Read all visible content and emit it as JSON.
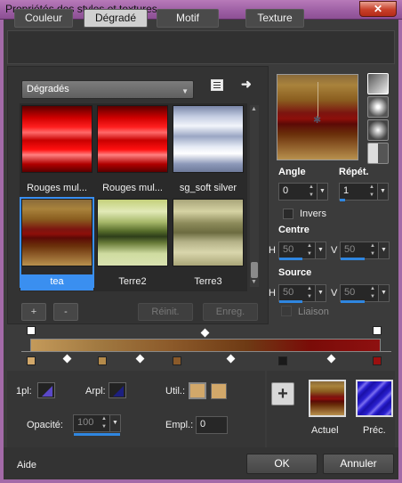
{
  "window": {
    "title": "Propriétés des styles et textures",
    "close": "✕"
  },
  "tabs": [
    "Couleur",
    "Dégradé",
    "Motif",
    "Texture"
  ],
  "category": {
    "value": "Dégradés"
  },
  "gradients": [
    {
      "name": "Rouges mul..."
    },
    {
      "name": "Rouges mul..."
    },
    {
      "name": "sg_soft silver"
    },
    {
      "name": "tea",
      "selected": true
    },
    {
      "name": "Terre2"
    },
    {
      "name": "Terre3"
    }
  ],
  "list_buttons": {
    "add": "+",
    "remove": "-",
    "reset": "Réinit.",
    "save": "Enreg."
  },
  "angle": {
    "label": "Angle",
    "value": "0"
  },
  "repeat": {
    "label": "Répét.",
    "value": "1"
  },
  "invert": {
    "label": "Invers"
  },
  "center": {
    "label": "Centre",
    "h_label": "H",
    "h_value": "50",
    "v_label": "V",
    "v_value": "50"
  },
  "source": {
    "label": "Source",
    "h_label": "H",
    "h_value": "50",
    "v_label": "V",
    "v_value": "50"
  },
  "link": {
    "label": "Liaison"
  },
  "stops": {
    "first_label": "1pl:",
    "arpl_label": "Arpl:",
    "util_label": "Util.:",
    "opacity_label": "Opacité:",
    "opacity_value": "100",
    "location_label": "Empl.:",
    "location_value": "0"
  },
  "current": {
    "label": "Actuel"
  },
  "previous": {
    "label": "Préc."
  },
  "bottom": {
    "help": "Aide",
    "ok": "OK",
    "cancel": "Annuler"
  },
  "colors": {
    "accent": "#3a8ff0",
    "title_bar": "#9c5ea3",
    "stop_tan": "#d2a86a",
    "stop_red": "#9a1010"
  }
}
